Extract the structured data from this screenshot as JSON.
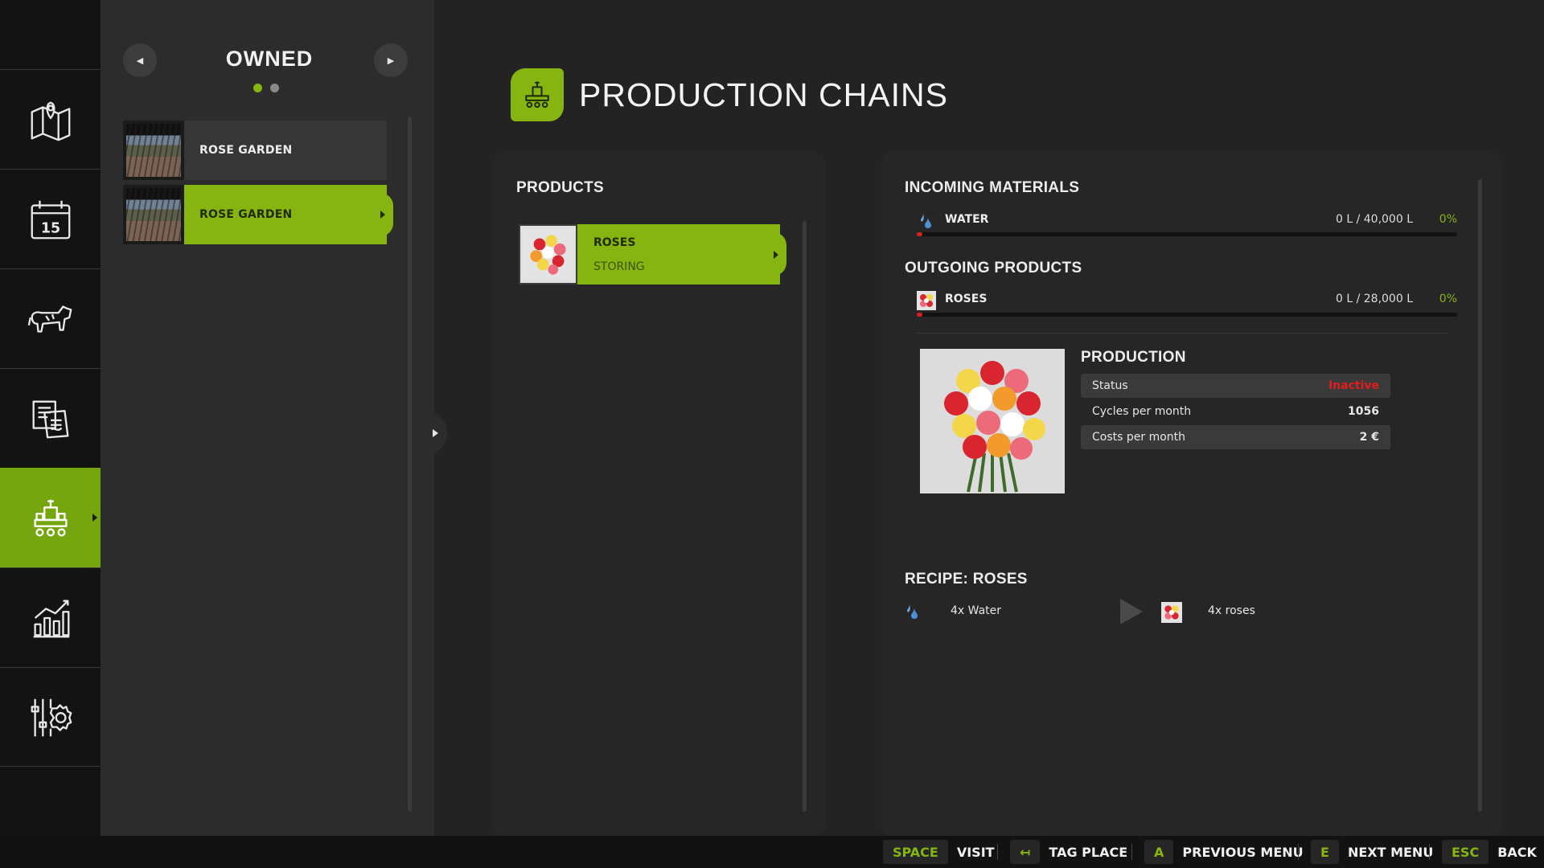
{
  "rail": {
    "items": [
      {
        "name": "map-icon"
      },
      {
        "name": "calendar-icon",
        "label": "15"
      },
      {
        "name": "animals-icon"
      },
      {
        "name": "contracts-icon"
      },
      {
        "name": "production-icon",
        "active": true
      },
      {
        "name": "statistics-icon"
      },
      {
        "name": "settings-icon"
      }
    ]
  },
  "owned": {
    "title": "OWNED",
    "prev_symbol": "◀",
    "next_symbol": "▶",
    "items": [
      {
        "label": "ROSE GARDEN",
        "selected": false
      },
      {
        "label": "ROSE GARDEN",
        "selected": true
      }
    ]
  },
  "header": {
    "title": "PRODUCTION CHAINS"
  },
  "products": {
    "title": "PRODUCTS",
    "items": [
      {
        "name": "ROSES",
        "status": "STORING"
      }
    ]
  },
  "incoming": {
    "title": "INCOMING MATERIALS",
    "items": [
      {
        "name": "WATER",
        "amount": "0 L / 40,000 L",
        "percent": "0%",
        "fill": 0
      }
    ]
  },
  "outgoing": {
    "title": "OUTGOING PRODUCTS",
    "items": [
      {
        "name": "ROSES",
        "amount": "0 L / 28,000 L",
        "percent": "0%",
        "fill": 0
      }
    ]
  },
  "production": {
    "title": "PRODUCTION",
    "rows": [
      {
        "label": "Status",
        "value": "Inactive"
      },
      {
        "label": "Cycles per month",
        "value": "1056"
      },
      {
        "label": "Costs per month",
        "value": "2 €"
      }
    ]
  },
  "recipe": {
    "title": "RECIPE: ROSES",
    "input": "4x Water",
    "output": "4x roses"
  },
  "hints": [
    {
      "key": "SPACE",
      "action": "VISIT"
    },
    {
      "key": "↤",
      "action": "TAG PLACE"
    },
    {
      "key": "A",
      "action": "PREVIOUS MENU"
    },
    {
      "key": "E",
      "action": "NEXT MENU"
    },
    {
      "key": "ESC",
      "action": "BACK"
    }
  ],
  "colors": {
    "accent": "#86b512",
    "danger": "#e01e1e",
    "background": "#232323"
  }
}
